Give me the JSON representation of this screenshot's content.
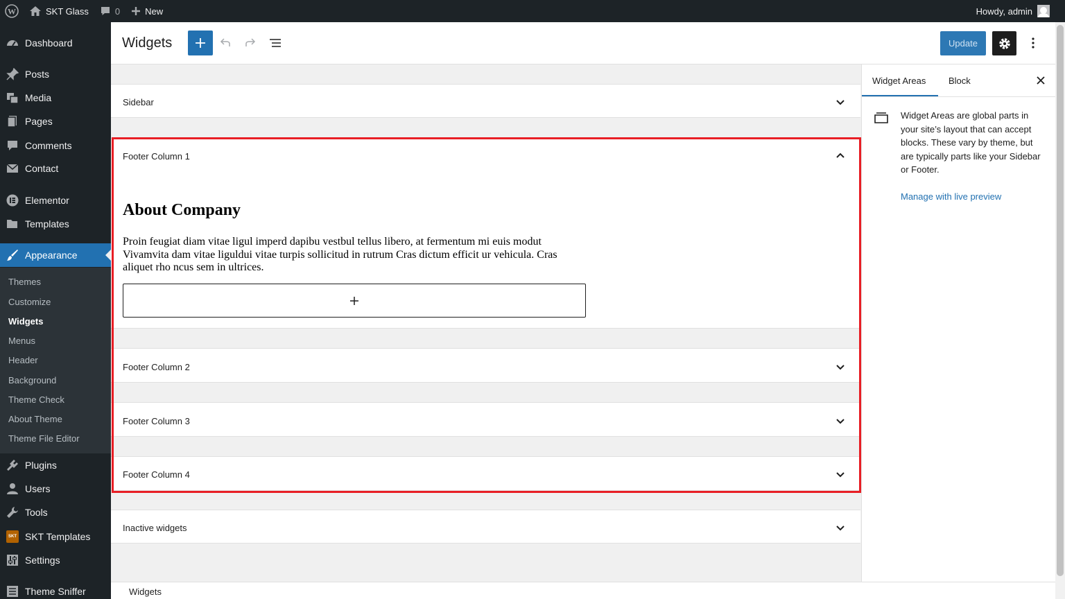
{
  "adminbar": {
    "site_name": "SKT Glass",
    "comments_count": "0",
    "new_label": "New",
    "howdy": "Howdy, admin"
  },
  "menu": {
    "items": [
      {
        "label": "Dashboard",
        "icon": "dashboard-icon"
      },
      {
        "label": "Posts",
        "icon": "pin-icon"
      },
      {
        "label": "Media",
        "icon": "media-icon"
      },
      {
        "label": "Pages",
        "icon": "page-icon"
      },
      {
        "label": "Comments",
        "icon": "comment-icon"
      },
      {
        "label": "Contact",
        "icon": "envelope-icon"
      },
      {
        "label": "Elementor",
        "icon": "elementor-icon"
      },
      {
        "label": "Templates",
        "icon": "folder-icon"
      },
      {
        "label": "Appearance",
        "icon": "brush-icon"
      },
      {
        "label": "Plugins",
        "icon": "plugin-icon"
      },
      {
        "label": "Users",
        "icon": "user-icon"
      },
      {
        "label": "Tools",
        "icon": "wrench-icon"
      },
      {
        "label": "SKT Templates",
        "icon": "skt-icon"
      },
      {
        "label": "Settings",
        "icon": "settings-icon"
      },
      {
        "label": "Theme Sniffer",
        "icon": "list-icon"
      }
    ],
    "submenu": [
      "Themes",
      "Customize",
      "Widgets",
      "Menus",
      "Header",
      "Background",
      "Theme Check",
      "About Theme",
      "Theme File Editor"
    ],
    "skt_badge": "SKT"
  },
  "header": {
    "title": "Widgets",
    "update_label": "Update"
  },
  "areas": {
    "sidebar": "Sidebar",
    "footer1": "Footer Column 1",
    "footer2": "Footer Column 2",
    "footer3": "Footer Column 3",
    "footer4": "Footer Column 4",
    "inactive": "Inactive widgets"
  },
  "footer1_content": {
    "heading": "About Company",
    "paragraph": "Proin feugiat diam vitae ligul imperd dapibu vestbul tellus libero, at fermentum mi euis modut Vivamvita dam vitae liguldui vitae turpis sollicitud in rutrum Cras dictum efficit ur vehicula. Cras aliquet rho ncus sem in ultrices."
  },
  "panel": {
    "tab_widget_areas": "Widget Areas",
    "tab_block": "Block",
    "description": "Widget Areas are global parts in your site’s layout that can accept blocks. These vary by theme, but are typically parts like your Sidebar or Footer.",
    "link": "Manage with live preview"
  },
  "footer": {
    "breadcrumb": "Widgets"
  },
  "colors": {
    "accent": "#2271b1",
    "admin_dark": "#1d2327",
    "highlight": "#e81e25"
  }
}
